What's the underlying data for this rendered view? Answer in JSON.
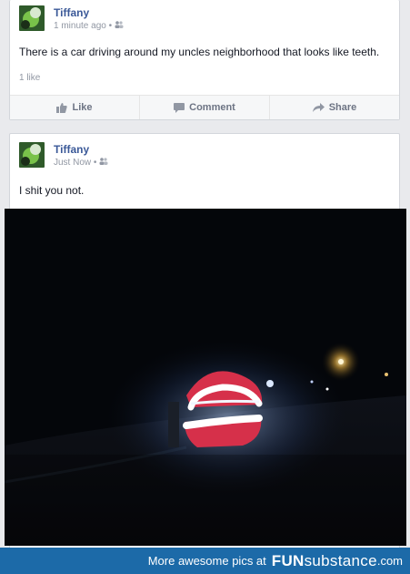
{
  "posts": [
    {
      "author": "Tiffany",
      "time": "1 minute ago",
      "audience_icon": "friends-icon",
      "text": "There is a car driving around my uncles neighborhood that looks like teeth.",
      "likes": "1 like",
      "actions": {
        "like": "Like",
        "comment": "Comment",
        "share": "Share"
      }
    },
    {
      "author": "Tiffany",
      "time": "Just Now",
      "audience_icon": "friends-icon",
      "text": "I shit you not.",
      "photo_alt": "teeth-car-photo"
    }
  ],
  "footer": {
    "text": "More awesome pics at",
    "brand_bold": "FUN",
    "brand_rest": "substance",
    "tld": ".com"
  },
  "colors": {
    "link": "#3b5998",
    "footer_bg": "#1c6aa8",
    "page_bg": "#e9eaed"
  }
}
